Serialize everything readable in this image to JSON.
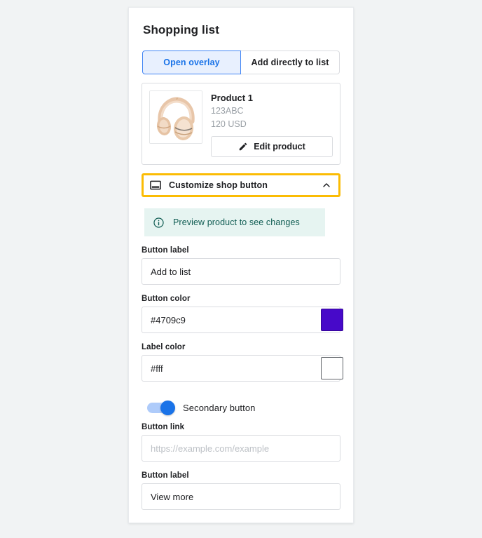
{
  "panel": {
    "title": "Shopping list"
  },
  "tabs": [
    {
      "label": "Open overlay",
      "selected": true
    },
    {
      "label": "Add directly to list",
      "selected": false
    }
  ],
  "product": {
    "image_icon": "headphones-image",
    "name": "Product 1",
    "sku": "123ABC",
    "price": "120 USD",
    "edit_button": {
      "label": "Edit product",
      "icon": "pencil-icon"
    }
  },
  "accordion": {
    "icon": "browser-window-icon",
    "label": "Customize shop button",
    "chevron": "chevron-up-icon",
    "highlight_color": "#fbbc04",
    "expanded": true
  },
  "banner": {
    "icon": "info-icon",
    "text": "Preview product to see changes",
    "background": "#e6f4f1",
    "text_color": "#0f5c52"
  },
  "form": {
    "button_label": {
      "label": "Button label",
      "value": "Add to list",
      "placeholder": ""
    },
    "button_color": {
      "label": "Button color",
      "value": "#4709c9",
      "placeholder": "",
      "swatch_color": "#4709c9"
    },
    "label_color": {
      "label": "Label color",
      "value": "#fff",
      "placeholder": "",
      "swatch_color": "#ffffff"
    },
    "secondary_toggle": {
      "label": "Secondary button",
      "on": true,
      "accent": "#1a73e8"
    },
    "button_link": {
      "label": "Button link",
      "value": "",
      "placeholder": "https://example.com/example"
    },
    "secondary_button_label": {
      "label": "Button label",
      "value": "View more",
      "placeholder": ""
    }
  }
}
